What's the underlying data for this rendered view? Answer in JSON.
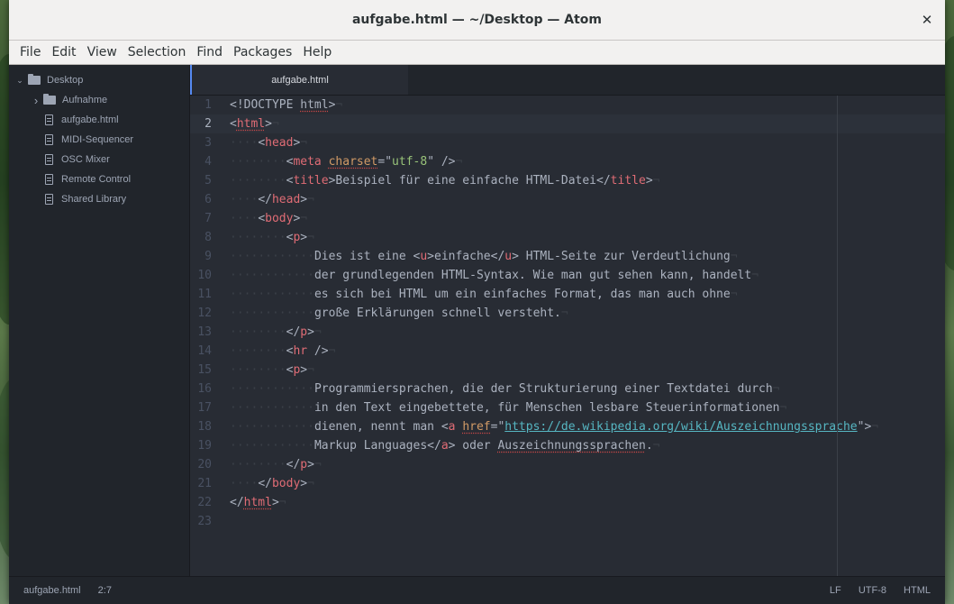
{
  "window": {
    "title": "aufgabe.html — ~/Desktop — Atom"
  },
  "menu": [
    "File",
    "Edit",
    "View",
    "Selection",
    "Find",
    "Packages",
    "Help"
  ],
  "tree": {
    "root": "Desktop",
    "items": [
      {
        "name": "Aufnahme",
        "type": "folder"
      },
      {
        "name": "aufgabe.html",
        "type": "file"
      },
      {
        "name": "MIDI-Sequencer",
        "type": "file"
      },
      {
        "name": "OSC Mixer",
        "type": "file"
      },
      {
        "name": "Remote Control",
        "type": "file"
      },
      {
        "name": "Shared Library",
        "type": "file"
      }
    ]
  },
  "tab": {
    "label": "aufgabe.html"
  },
  "editor": {
    "cursor_line": 2,
    "lines": [
      "<!DOCTYPE html>",
      "<html>",
      "    <head>",
      "        <meta charset=\"utf-8\" />",
      "        <title>Beispiel für eine einfache HTML-Datei</title>",
      "    </head>",
      "    <body>",
      "        <p>",
      "            Dies ist eine <u>einfache</u> HTML-Seite zur Verdeutlichung",
      "            der grundlegenden HTML-Syntax. Wie man gut sehen kann, handelt",
      "            es sich bei HTML um ein einfaches Format, das man auch ohne",
      "            große Erklärungen schnell versteht.",
      "        </p>",
      "        <hr />",
      "        <p>",
      "            Programmiersprachen, die der Strukturierung einer Textdatei durch",
      "            in den Text eingebettete, für Menschen lesbare Steuerinformationen",
      "            dienen, nennt man <a href=\"https://de.wikipedia.org/wiki/Auszeichnungssprache\">",
      "            Markup Languages</a> oder Auszeichnungssprachen.",
      "        </p>",
      "    </body>",
      "</html>",
      ""
    ]
  },
  "status": {
    "file": "aufgabe.html",
    "position": "2:7",
    "line_ending": "LF",
    "encoding": "UTF-8",
    "grammar": "HTML"
  }
}
